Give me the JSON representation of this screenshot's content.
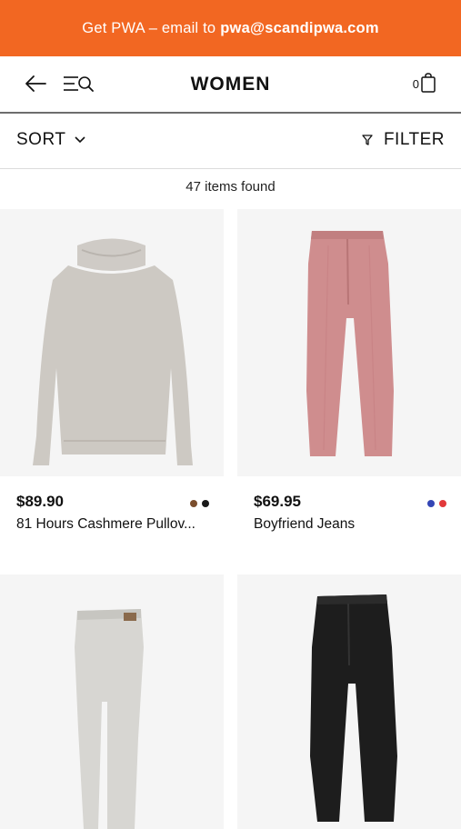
{
  "banner": {
    "text": "Get PWA – email to",
    "email": "pwa@scandipwa.com",
    "color": "#f26722"
  },
  "header": {
    "title": "WOMEN",
    "cart_count": "0",
    "back_icon": "arrow-left-icon",
    "menu_icon": "menu-search-icon",
    "cart_icon": "shopping-bag-icon"
  },
  "toolbar": {
    "sort_label": "SORT",
    "filter_label": "FILTER"
  },
  "results": {
    "count_text": "47 items found"
  },
  "products": [
    {
      "price": "$89.90",
      "name": "81 Hours Cashmere Pullov...",
      "swatches": [
        "#7a4e2d",
        "#1a1a1a"
      ]
    },
    {
      "price": "$69.95",
      "name": "Boyfriend Jeans",
      "swatches": [
        "#3446b5",
        "#e2393a"
      ]
    },
    {
      "price": "",
      "name": "",
      "swatches": []
    },
    {
      "price": "",
      "name": "",
      "swatches": []
    }
  ]
}
